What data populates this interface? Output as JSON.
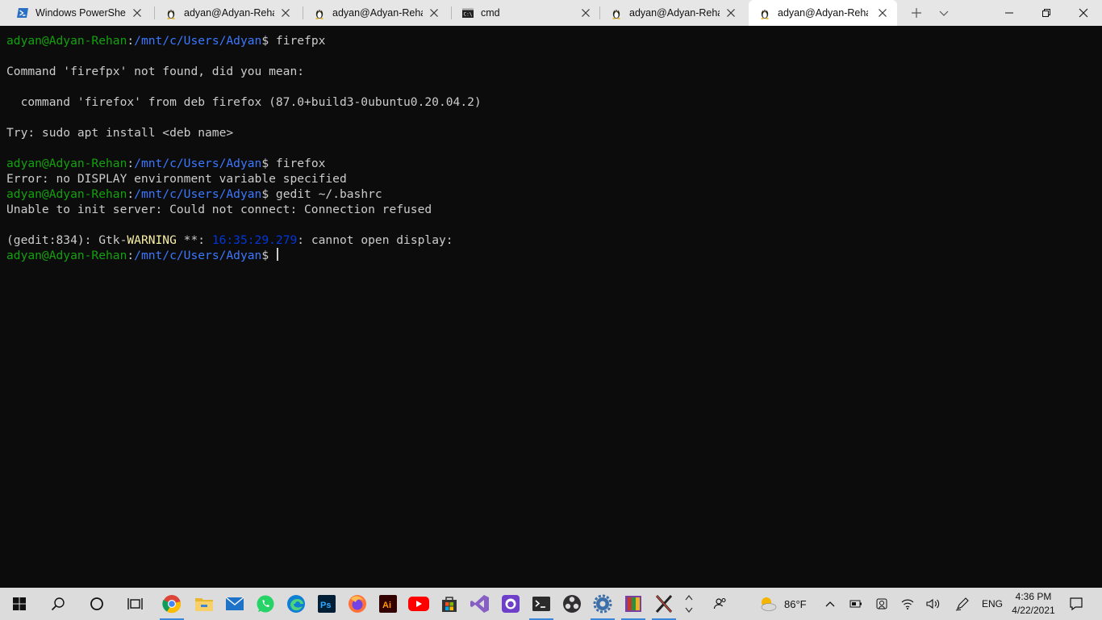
{
  "tabs": [
    {
      "title": "Windows PowerShell",
      "icon": "powershell-icon"
    },
    {
      "title": "adyan@Adyan-Rehan",
      "icon": "linux-penguin-icon"
    },
    {
      "title": "adyan@Adyan-Rehan",
      "icon": "linux-penguin-icon"
    },
    {
      "title": "cmd",
      "icon": "cmd-icon"
    },
    {
      "title": "adyan@Adyan-Rehan",
      "icon": "linux-penguin-icon"
    },
    {
      "title": "adyan@Adyan-Rehan",
      "icon": "linux-penguin-icon",
      "active": true
    }
  ],
  "prompt": {
    "user": "adyan@Adyan-Rehan",
    "colon": ":",
    "path": "/mnt/c/Users/Adyan",
    "symbol": "$ "
  },
  "terminal": {
    "cmd1": "firefpx",
    "out1": "Command 'firefpx' not found, did you mean:",
    "out2": "  command 'firefox' from deb firefox (87.0+build3-0ubuntu0.20.04.2)",
    "out3": "Try: sudo apt install <deb name>",
    "cmd2": "firefox",
    "out4": "Error: no DISPLAY environment variable specified",
    "cmd3": "gedit ~/.bashrc",
    "out5": "Unable to init server: Could not connect: Connection refused",
    "gtk_prefix": "(gedit:834): Gtk-",
    "gtk_warn": "WARNING",
    "gtk_mid": " **: ",
    "gtk_time": "16:35:29.279",
    "gtk_suffix": ": cannot open display:"
  },
  "taskbar": {
    "apps": [
      "chrome-icon",
      "file-explorer-icon",
      "mail-icon",
      "whatsapp-icon",
      "edge-icon",
      "photoshop-icon",
      "firefox-icon",
      "illustrator-icon",
      "youtube-icon",
      "store-icon",
      "visual-studio-icon",
      "github-desktop-icon",
      "terminal-icon",
      "obs-icon",
      "settings-icon",
      "winrar-icon",
      "xming-icon"
    ],
    "weather": "86°F",
    "language": "ENG",
    "time": "4:36 PM",
    "date": "4/22/2021"
  },
  "colors": {
    "user": "#13a10e",
    "path": "#3b78ff",
    "text": "#cccccc",
    "background": "#0c0c0c"
  }
}
